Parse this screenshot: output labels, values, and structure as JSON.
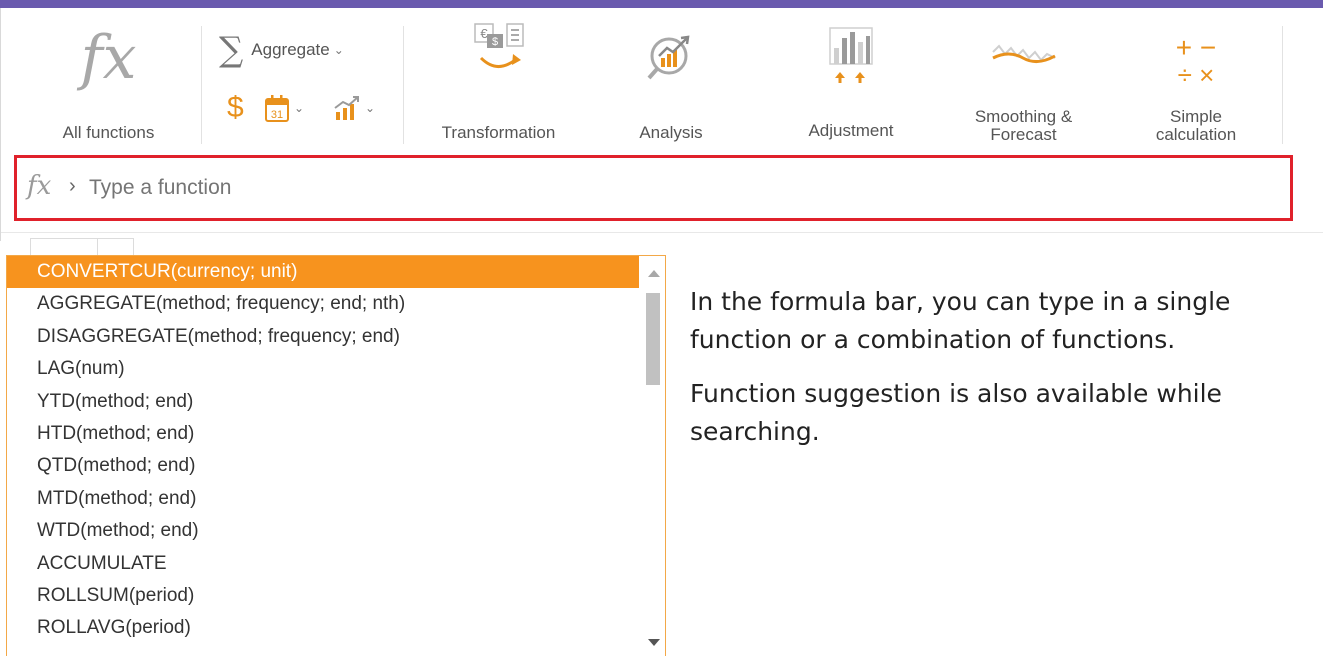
{
  "toolbar": {
    "all_functions_label": "All functions",
    "aggregate_label": "Aggregate",
    "transformation_label": "Transformation",
    "analysis_label": "Analysis",
    "adjustment_label": "Adjustment",
    "smoothing_label": "Smoothing & Forecast",
    "simple_calc_label": "Simple calculation",
    "calendar_day": "31",
    "fx_glyph": "fx",
    "sigma_glyph": "∑",
    "dollar_glyph": "$",
    "plus_minus_glyph": "+ −",
    "div_times_glyph": "÷ ×"
  },
  "formula_bar": {
    "placeholder": "Type a function",
    "value": "",
    "fx_glyph": "fx",
    "arrow_glyph": "›"
  },
  "suggestions": {
    "items": [
      "CONVERTCUR(currency; unit)",
      "AGGREGATE(method; frequency; end; nth)",
      "DISAGGREGATE(method; frequency; end)",
      "LAG(num)",
      "YTD(method; end)",
      "HTD(method; end)",
      "QTD(method; end)",
      "MTD(method; end)",
      "WTD(method; end)",
      "ACCUMULATE",
      "ROLLSUM(period)",
      "ROLLAVG(period)"
    ]
  },
  "description": {
    "paragraph_1": "In the formula bar, you can type in a single function or a combination of functions.",
    "paragraph_2": "Function suggestion is also available while searching."
  },
  "colors": {
    "accent_top_bar": "#6a5aae",
    "highlight_row": "#f7931e",
    "formula_border": "#e0212b",
    "icon_orange": "#e8911c",
    "icon_gray": "#9a9a9a"
  }
}
